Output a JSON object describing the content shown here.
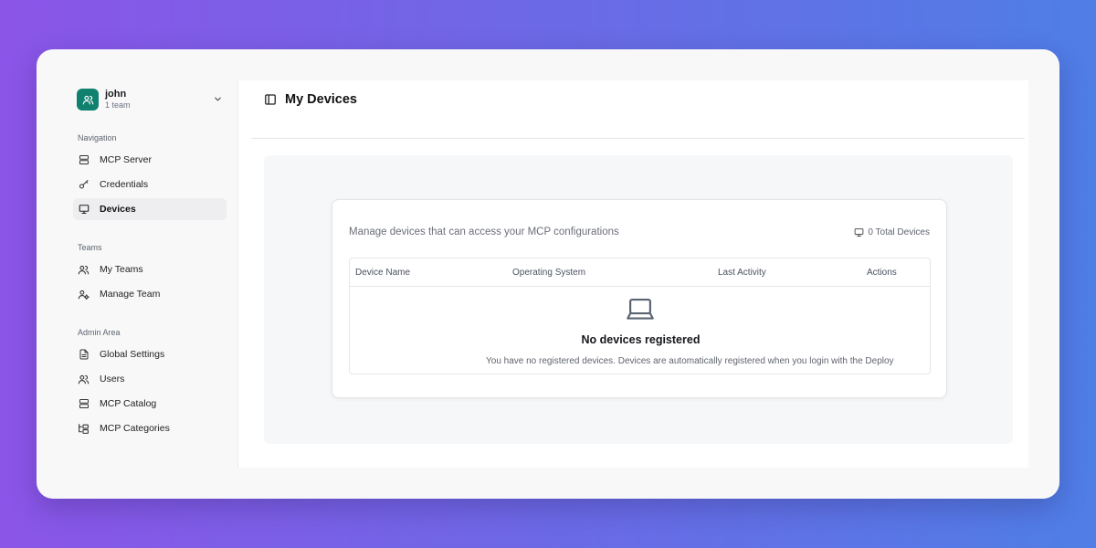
{
  "team_switcher": {
    "name": "john",
    "subtitle": "1 team"
  },
  "sidebar": {
    "sections": [
      {
        "label": "Navigation",
        "items": [
          {
            "label": "MCP Server",
            "icon": "server-icon"
          },
          {
            "label": "Credentials",
            "icon": "key-icon"
          },
          {
            "label": "Devices",
            "icon": "monitor-icon",
            "active": true
          }
        ]
      },
      {
        "label": "Teams",
        "items": [
          {
            "label": "My Teams",
            "icon": "users-icon"
          },
          {
            "label": "Manage Team",
            "icon": "user-cog-icon"
          }
        ]
      },
      {
        "label": "Admin Area",
        "items": [
          {
            "label": "Global Settings",
            "icon": "file-text-icon"
          },
          {
            "label": "Users",
            "icon": "users-icon"
          },
          {
            "label": "MCP Catalog",
            "icon": "server-icon"
          },
          {
            "label": "MCP Categories",
            "icon": "folder-tree-icon"
          }
        ]
      }
    ]
  },
  "header": {
    "title": "My Devices"
  },
  "card": {
    "description": "Manage devices that can access your MCP configurations",
    "total_devices": "0 Total Devices"
  },
  "table": {
    "columns": [
      "Device Name",
      "Operating System",
      "Last Activity",
      "Actions"
    ],
    "empty_title": "No devices registered",
    "empty_description": "You have no registered devices. Devices are automatically registered when you login with the Deploy"
  },
  "colors": {
    "accent": "#10806f",
    "active_bg": "#eeeef0"
  }
}
